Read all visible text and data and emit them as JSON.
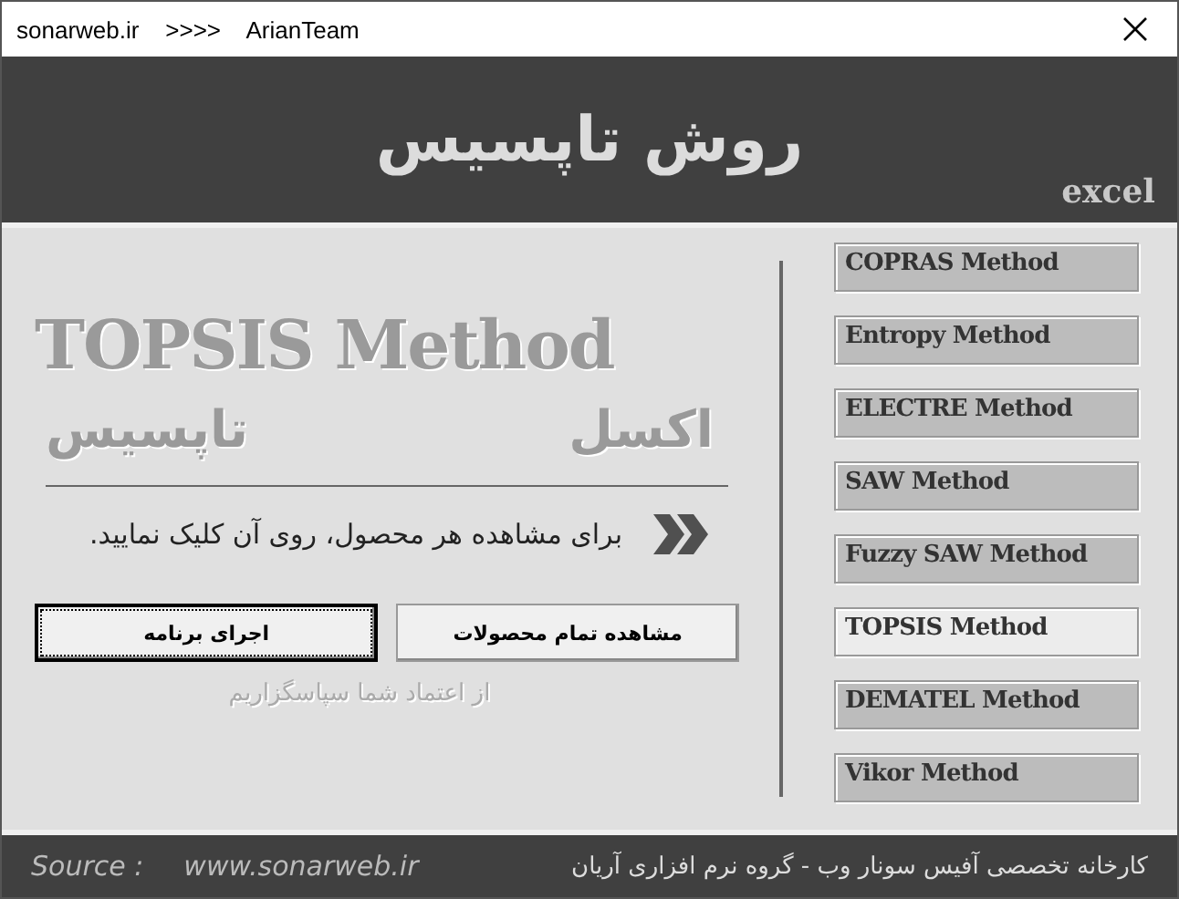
{
  "window": {
    "title": "sonarweb.ir    >>>>    ArianTeam"
  },
  "header": {
    "title": "روش تاپسیس",
    "tag": "excel"
  },
  "main": {
    "title": "TOPSIS Method",
    "subtitle_right": "اکسل",
    "subtitle_left": "تاپسیس",
    "instruction": "برای مشاهده هر محصول، روی آن کلیک نمایید.",
    "buttons": [
      {
        "label": "مشاهده تمام محصولات",
        "focused": false
      },
      {
        "label": "اجرای برنامه",
        "focused": true
      }
    ],
    "thanks": "از اعتماد شما سپاسگزاریم"
  },
  "methods": [
    {
      "label": "COPRAS Method",
      "selected": false
    },
    {
      "label": "Entropy Method",
      "selected": false
    },
    {
      "label": "ELECTRE Method",
      "selected": false
    },
    {
      "label": "SAW Method",
      "selected": false
    },
    {
      "label": "Fuzzy SAW Method",
      "selected": false
    },
    {
      "label": "TOPSIS Method",
      "selected": true
    },
    {
      "label": "DEMATEL Method",
      "selected": false
    },
    {
      "label": "Vikor Method",
      "selected": false
    }
  ],
  "footer": {
    "source_label": "Source :",
    "source_url": "www.sonarweb.ir",
    "credit": "کارخانه تخصصی آفیس سونار وب - گروه نرم افزاری آریان"
  }
}
